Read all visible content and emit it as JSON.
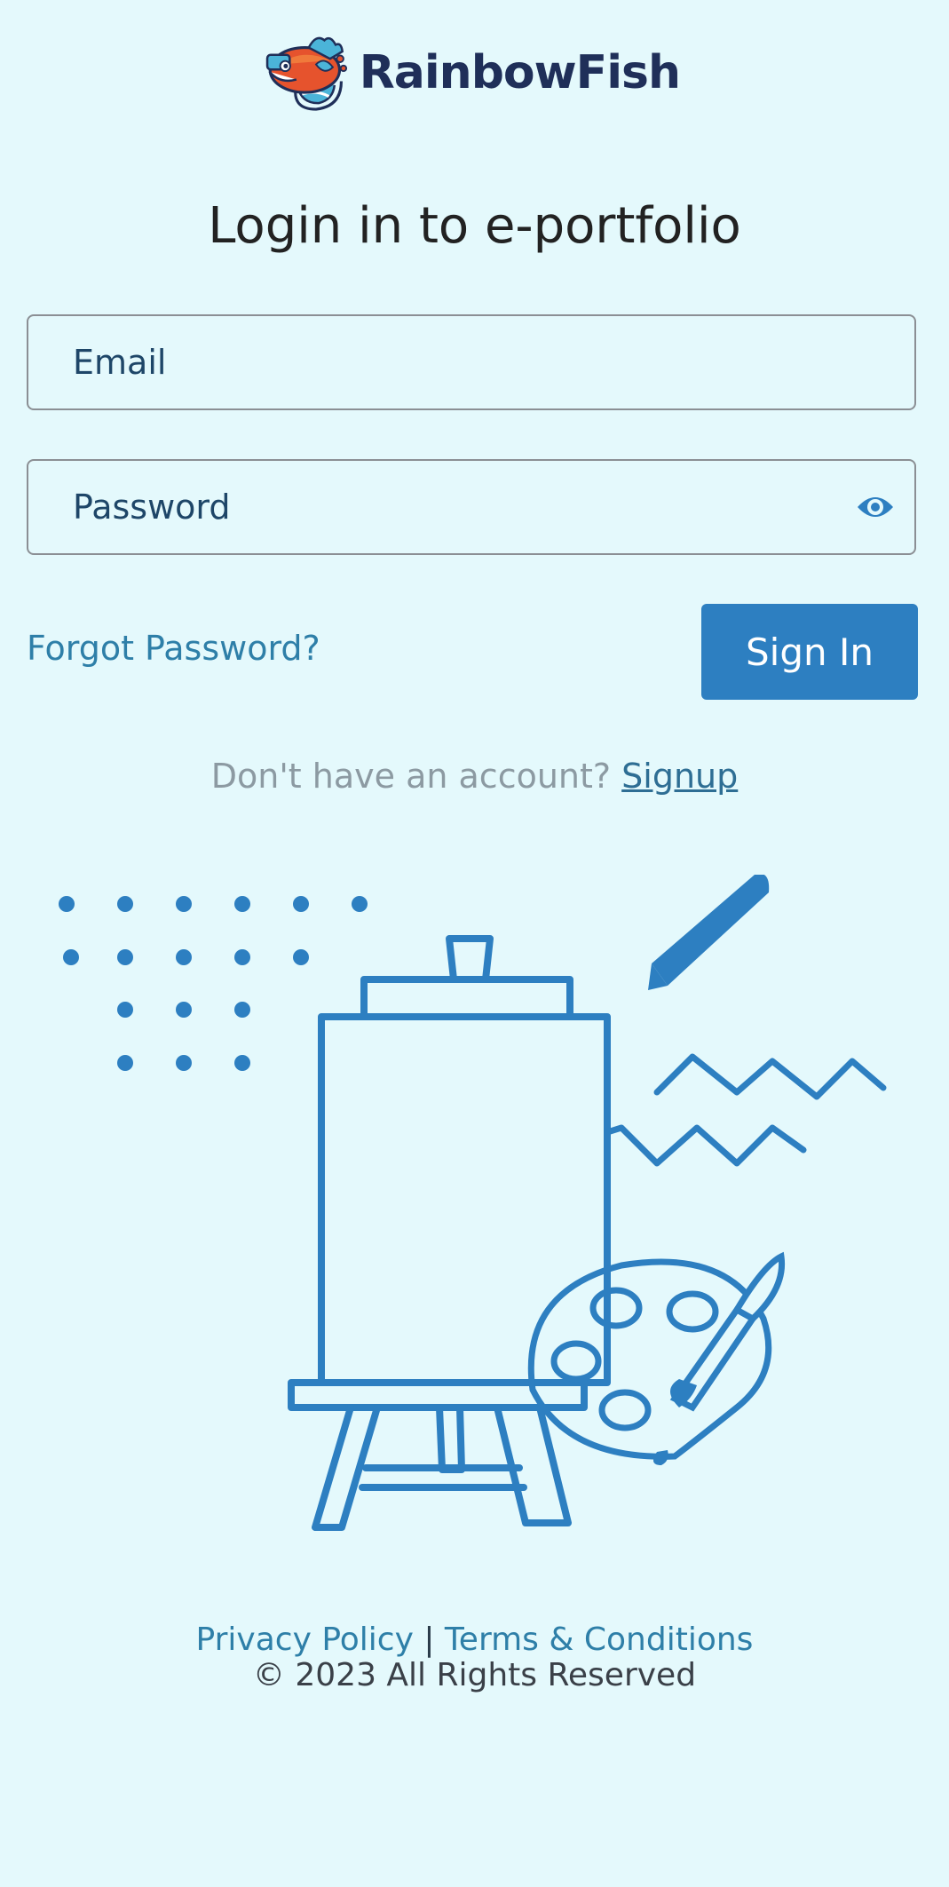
{
  "brand": {
    "name": "RainbowFish",
    "logo_icon": "rainbow-fish-logo",
    "text_color": "#1f2f59"
  },
  "page": {
    "title": "Login in to e-portfolio",
    "background": "#e4f9fc"
  },
  "form": {
    "email_placeholder": "Email",
    "email_value": "",
    "password_placeholder": "Password",
    "password_value": "",
    "password_toggle_icon": "eye-icon",
    "forgot_label": "Forgot Password?",
    "signin_label": "Sign In",
    "accent": "#2d7fc1"
  },
  "signup": {
    "prompt": "Don't have an account?",
    "link_label": "Signup"
  },
  "illustration": {
    "description_icon": "easel-palette-illustration",
    "color": "#2d7fc1"
  },
  "footer": {
    "privacy_label": "Privacy Policy",
    "separator": "|",
    "terms_label": "Terms & Conditions",
    "copyright": "© 2023 All Rights Reserved"
  }
}
